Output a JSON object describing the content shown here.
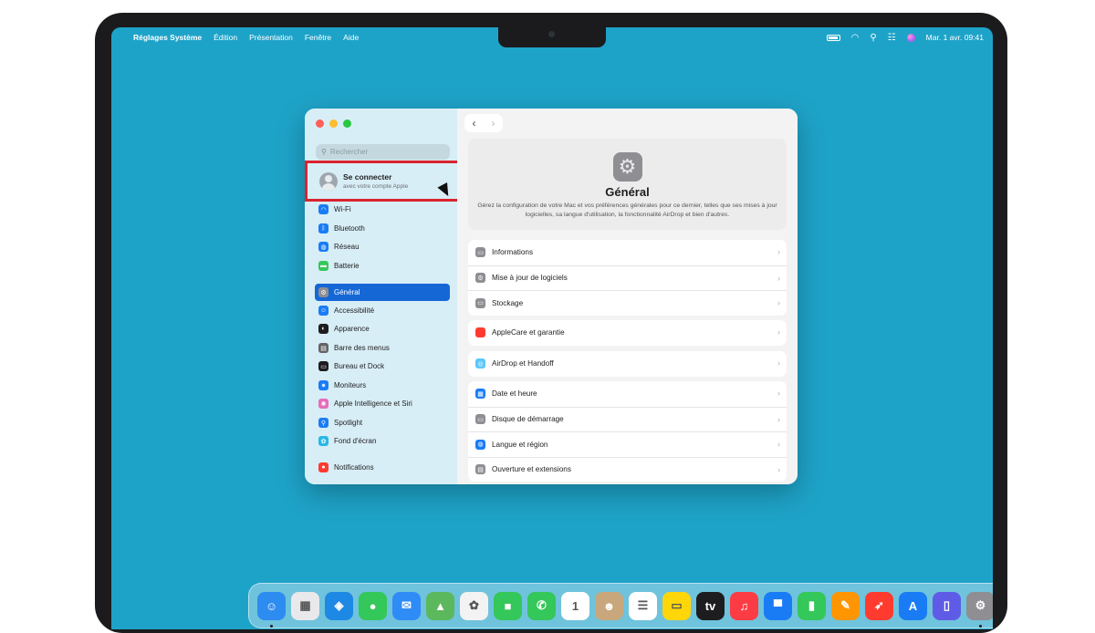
{
  "menubar": {
    "apple_icon": "apple-logo-icon",
    "app_name": "Réglages Système",
    "menus": [
      "Édition",
      "Présentation",
      "Fenêtre",
      "Aide"
    ],
    "date_time": "Mar. 1 avr.  09:41"
  },
  "sidebar": {
    "search_placeholder": "Rechercher",
    "account": {
      "title": "Se connecter",
      "subtitle": "avec votre compte Apple"
    },
    "items": [
      {
        "label": "Wi-Fi",
        "icon": "wifi-icon",
        "color": "#1a7cf5"
      },
      {
        "label": "Bluetooth",
        "icon": "bluetooth-icon",
        "color": "#1a7cf5"
      },
      {
        "label": "Réseau",
        "icon": "globe-icon",
        "color": "#1a7cf5"
      },
      {
        "label": "Batterie",
        "icon": "battery-icon",
        "color": "#34c759"
      },
      {
        "label": "Général",
        "icon": "gear-icon",
        "color": "#8e8e93",
        "active": true
      },
      {
        "label": "Accessibilité",
        "icon": "accessibility-icon",
        "color": "#1a7cf5"
      },
      {
        "label": "Apparence",
        "icon": "appearance-icon",
        "color": "#1d1d1f"
      },
      {
        "label": "Barre des menus",
        "icon": "menubar-icon",
        "color": "#636366"
      },
      {
        "label": "Bureau et Dock",
        "icon": "dock-icon",
        "color": "#1d1d1f"
      },
      {
        "label": "Moniteurs",
        "icon": "display-icon",
        "color": "#1a7cf5"
      },
      {
        "label": "Apple Intelligence et Siri",
        "icon": "siri-icon",
        "color": "#e56dbb"
      },
      {
        "label": "Spotlight",
        "icon": "spotlight-icon",
        "color": "#1a7cf5"
      },
      {
        "label": "Fond d'écran",
        "icon": "wallpaper-icon",
        "color": "#2ab7e8"
      },
      {
        "label": "Notifications",
        "icon": "bell-icon",
        "color": "#ff3b30"
      }
    ]
  },
  "content": {
    "title": "Général",
    "description": "Gérez la configuration de votre Mac et vos préférences générales pour ce dernier, telles que ses mises à jour logicielles, sa langue d'utilisation, la fonctionnalité AirDrop et bien d'autres.",
    "groups": [
      [
        {
          "label": "Informations",
          "icon": "info-icon",
          "color": "#8e8e93"
        },
        {
          "label": "Mise à jour de logiciels",
          "icon": "update-gear-icon",
          "color": "#8e8e93"
        },
        {
          "label": "Stockage",
          "icon": "storage-icon",
          "color": "#8e8e93"
        }
      ],
      [
        {
          "label": "AppleCare et garantie",
          "icon": "applecare-icon",
          "color": "#ff3b30"
        }
      ],
      [
        {
          "label": "AirDrop et Handoff",
          "icon": "airdrop-icon",
          "color": "#5ac8fa"
        }
      ],
      [
        {
          "label": "Date et heure",
          "icon": "calendar-clock-icon",
          "color": "#1a7cf5"
        },
        {
          "label": "Disque de démarrage",
          "icon": "disk-icon",
          "color": "#8e8e93"
        },
        {
          "label": "Langue et région",
          "icon": "globe-icon",
          "color": "#1a7cf5"
        },
        {
          "label": "Ouverture et extensions",
          "icon": "login-items-icon",
          "color": "#8e8e93"
        }
      ]
    ]
  },
  "dock": {
    "apps": [
      {
        "name": "finder-icon",
        "color": "#2d8cf0",
        "glyph": "☺",
        "running": true
      },
      {
        "name": "launchpad-icon",
        "color": "#e9e9ec",
        "glyph": "▦"
      },
      {
        "name": "safari-icon",
        "color": "#1e88e5",
        "glyph": "◈"
      },
      {
        "name": "messages-icon",
        "color": "#34c759",
        "glyph": "●"
      },
      {
        "name": "mail-icon",
        "color": "#2f8cf6",
        "glyph": "✉"
      },
      {
        "name": "maps-icon",
        "color": "#5cb85c",
        "glyph": "▲"
      },
      {
        "name": "photos-icon",
        "color": "#f3f3f3",
        "glyph": "✿"
      },
      {
        "name": "facetime-icon",
        "color": "#34c759",
        "glyph": "■"
      },
      {
        "name": "phone-icon",
        "color": "#34c759",
        "glyph": "✆"
      },
      {
        "name": "calendar-icon",
        "color": "#ffffff",
        "glyph": "1"
      },
      {
        "name": "contacts-icon",
        "color": "#c8a77c",
        "glyph": "☻"
      },
      {
        "name": "reminders-icon",
        "color": "#ffffff",
        "glyph": "☰"
      },
      {
        "name": "notes-icon",
        "color": "#ffd60a",
        "glyph": "▭"
      },
      {
        "name": "tv-icon",
        "color": "#1d1d1f",
        "glyph": "tv"
      },
      {
        "name": "music-icon",
        "color": "#fc3c44",
        "glyph": "♫"
      },
      {
        "name": "keynote-icon",
        "color": "#1a7cf5",
        "glyph": "▀"
      },
      {
        "name": "numbers-icon",
        "color": "#34c759",
        "glyph": "▮"
      },
      {
        "name": "pages-icon",
        "color": "#ff9500",
        "glyph": "✎"
      },
      {
        "name": "testflight-icon",
        "color": "#ff3b30",
        "glyph": "➶"
      },
      {
        "name": "app-store-icon",
        "color": "#1a7cf5",
        "glyph": "A"
      },
      {
        "name": "iphone-mirroring-icon",
        "color": "#5e5ce6",
        "glyph": "▯"
      },
      {
        "name": "system-settings-icon",
        "color": "#8e8e93",
        "glyph": "⚙",
        "running": true
      }
    ],
    "trailing": [
      {
        "name": "downloads-folder-icon",
        "color": "#5aa9d6",
        "glyph": "⬇"
      },
      {
        "name": "trash-icon",
        "color": "#c7ccd0",
        "glyph": "🗑"
      }
    ]
  }
}
